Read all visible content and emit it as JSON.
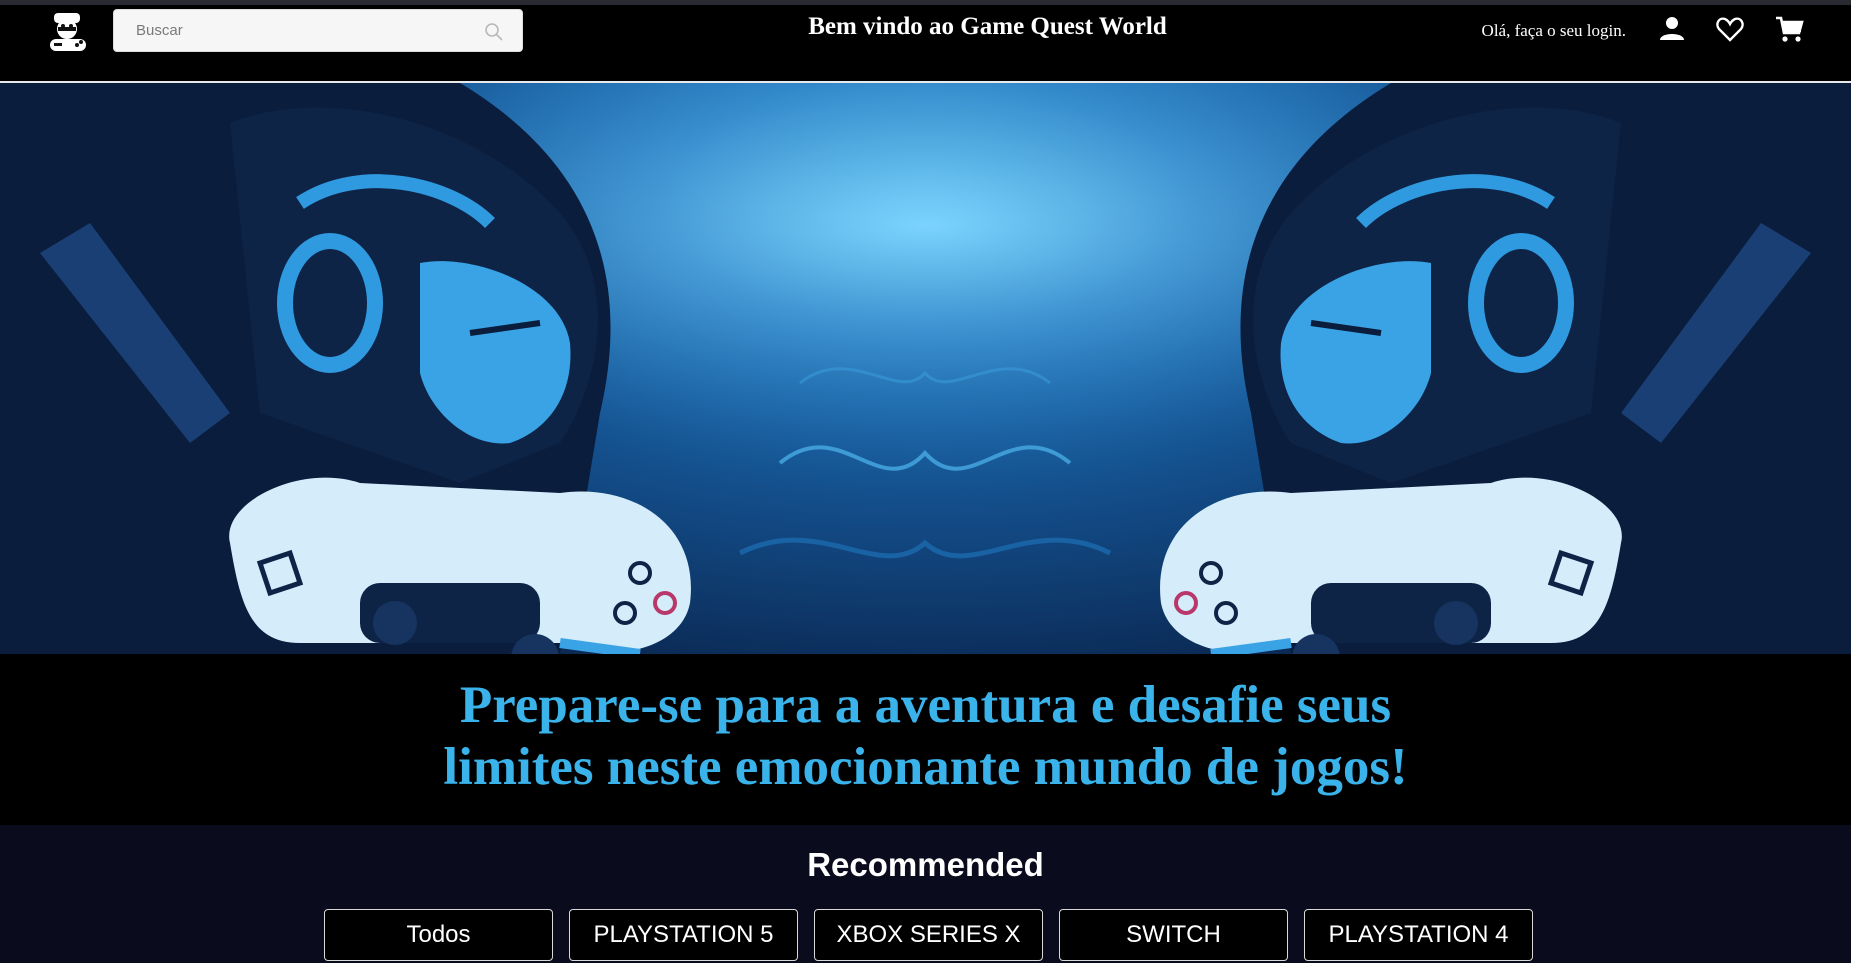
{
  "header": {
    "logo_icon": "mario-controller-logo-icon",
    "search": {
      "placeholder": "Buscar",
      "value": ""
    },
    "welcome_title": "Bem vindo ao Game Quest World",
    "login_text": "Olá, faça o seu login.",
    "icons": [
      "user-icon",
      "heart-icon",
      "cart-icon"
    ]
  },
  "hero": {
    "description": "banner-illustration"
  },
  "tagline": {
    "line1": "Prepare-se para a aventura e desafie seus",
    "line2": "limites neste emocionante mundo de jogos!",
    "color": "#3ab3ea"
  },
  "recommended": {
    "title": "Recommended",
    "filters": [
      "Todos",
      "PLAYSTATION 5",
      "XBOX SERIES X",
      "SWITCH",
      "PLAYSTATION 4"
    ]
  },
  "colors": {
    "header_bg": "#000000",
    "section_bg": "#0b0b1e",
    "accent": "#3ab3ea"
  }
}
